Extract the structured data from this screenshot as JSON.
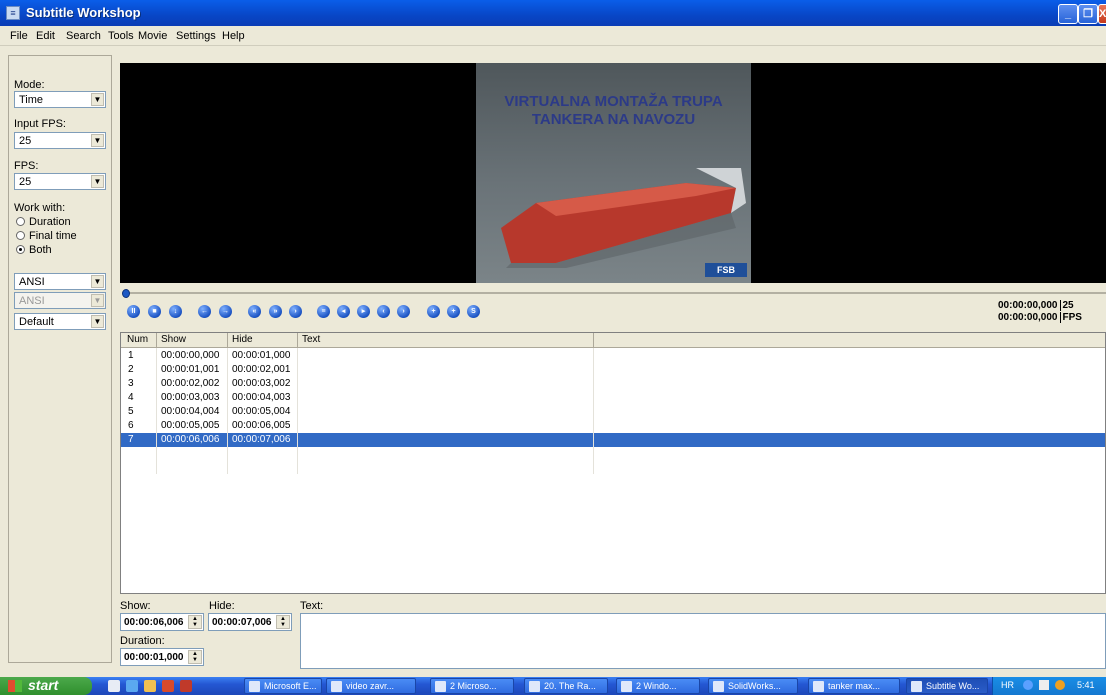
{
  "window": {
    "title": "Subtitle Workshop",
    "minimize": "_",
    "restore": "❐",
    "close": "X"
  },
  "menu": [
    "File",
    "Edit",
    "Search",
    "Tools",
    "Movie",
    "Settings",
    "Help"
  ],
  "left_panel": {
    "mode_label": "Mode:",
    "mode_value": "Time",
    "input_fps_label": "Input FPS:",
    "input_fps_value": "25",
    "fps_label": "FPS:",
    "fps_value": "25",
    "work_with_label": "Work with:",
    "radios": [
      {
        "label": "Duration",
        "checked": false
      },
      {
        "label": "Final time",
        "checked": false
      },
      {
        "label": "Both",
        "checked": true
      }
    ],
    "charset_value": "ANSI",
    "charset2_value": "ANSI",
    "format_value": "Default"
  },
  "video": {
    "title_line1": "VIRTUALNA MONTAŽA TRUPA",
    "title_line2": "TANKERA NA NAVOZU",
    "logo": "FSB"
  },
  "timecodes": {
    "line1_time": "00:00:00,000",
    "line1_val": "25",
    "line2_time": "00:00:00,000",
    "line2_val": "FPS"
  },
  "table": {
    "headers": [
      "Num",
      "Show",
      "Hide",
      "Text"
    ],
    "rows": [
      {
        "num": "1",
        "show": "00:00:00,000",
        "hide": "00:00:01,000",
        "text": ""
      },
      {
        "num": "2",
        "show": "00:00:01,001",
        "hide": "00:00:02,001",
        "text": ""
      },
      {
        "num": "3",
        "show": "00:00:02,002",
        "hide": "00:00:03,002",
        "text": ""
      },
      {
        "num": "4",
        "show": "00:00:03,003",
        "hide": "00:00:04,003",
        "text": ""
      },
      {
        "num": "5",
        "show": "00:00:04,004",
        "hide": "00:00:05,004",
        "text": ""
      },
      {
        "num": "6",
        "show": "00:00:05,005",
        "hide": "00:00:06,005",
        "text": ""
      },
      {
        "num": "7",
        "show": "00:00:06,006",
        "hide": "00:00:07,006",
        "text": "",
        "selected": true
      }
    ]
  },
  "editor": {
    "show_label": "Show:",
    "show_value": "00:00:06,006",
    "hide_label": "Hide:",
    "hide_value": "00:00:07,006",
    "duration_label": "Duration:",
    "duration_value": "00:00:01,000",
    "text_label": "Text:"
  },
  "taskbar": {
    "start": "start",
    "tasks": [
      "Microsoft E...",
      "video zavr...",
      "2 Microso...",
      "20. The Ra...",
      "2 Windo...",
      "SolidWorks...",
      "tanker max...",
      "Subtitle Wo..."
    ],
    "language": "HR",
    "clock": "5:41"
  },
  "colors": {
    "selection": "#316ac5",
    "titlebar": "#0846c6",
    "taskbar": "#2457d3"
  }
}
